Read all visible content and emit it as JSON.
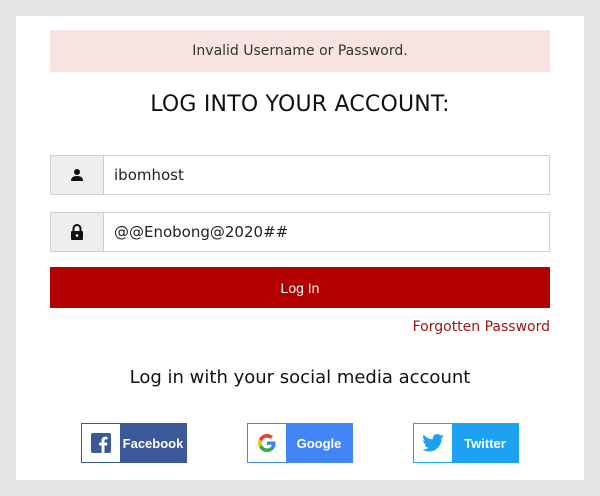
{
  "alert": {
    "text": "Invalid Username or Password."
  },
  "title": "LOG INTO YOUR ACCOUNT:",
  "username": {
    "value": "ibomhost",
    "icon": "user-icon"
  },
  "password": {
    "value": "@@Enobong@2020##",
    "icon": "lock-icon"
  },
  "login_button": "Log In",
  "forgot_link": "Forgotten Password",
  "social_title": "Log in with your social media account",
  "social": {
    "facebook": "Facebook",
    "google": "Google",
    "twitter": "Twitter"
  },
  "colors": {
    "primary": "#b30000",
    "alert_bg": "#f7e3e0",
    "link": "#a01515",
    "facebook": "#3b5998",
    "google": "#4285f4",
    "twitter": "#1da1f2"
  }
}
